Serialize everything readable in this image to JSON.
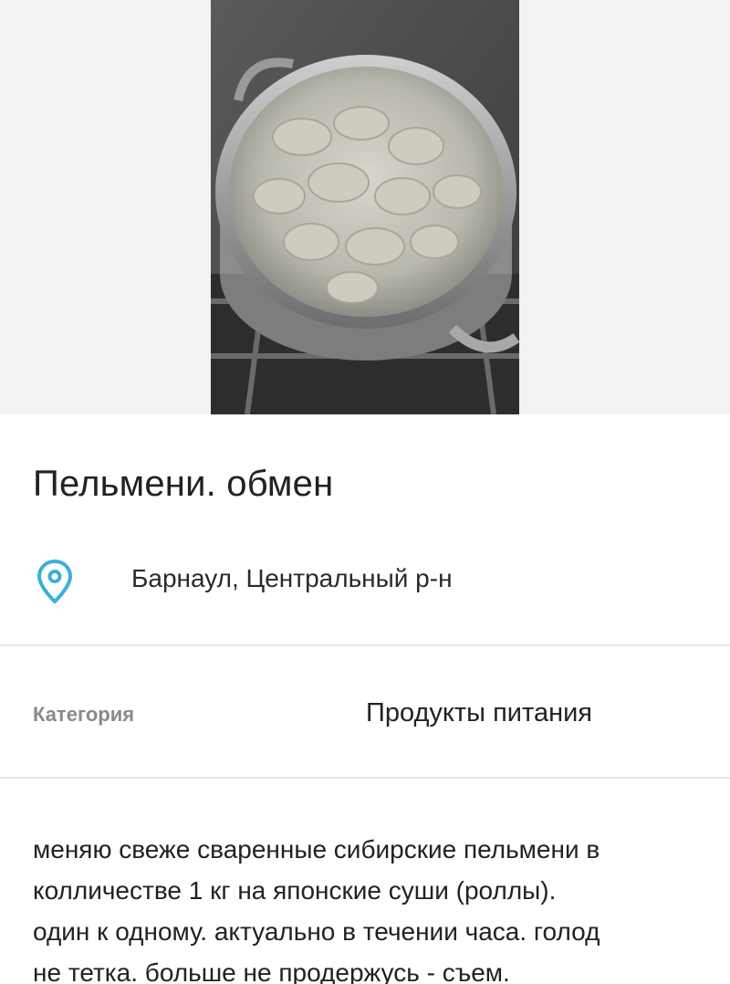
{
  "listing": {
    "photo_alt": "pot-of-dumplings-photo",
    "title": "Пельмени. обмен",
    "location": {
      "icon": "map-pin-icon",
      "text": "Барнаул, Центральный р-н"
    },
    "category": {
      "label": "Категория",
      "value": "Продукты питания"
    },
    "description_lines": [
      "меняю свеже сваренные сибирские пельмени в",
      "колличестве 1 кг на японские суши (роллы).",
      "один к одному.  актуально в течении часа. голод",
      "не тетка. больше не продержусь - съем."
    ]
  },
  "colors": {
    "accent": "#3ab0d8",
    "text": "#222222",
    "muted": "#8a8a8a",
    "divider": "#e8e8e8",
    "photo_background": "#f2f2f2"
  }
}
